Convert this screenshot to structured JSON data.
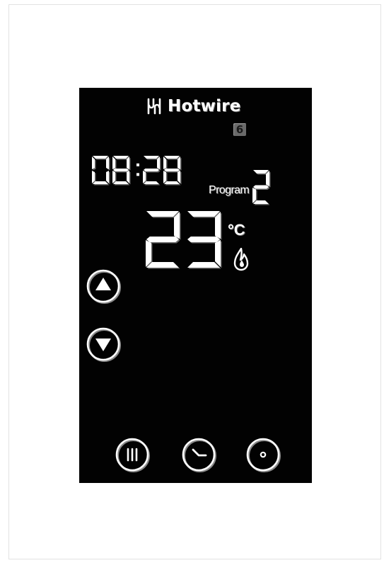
{
  "brand": {
    "name": "Hotwire",
    "logo_icon": "hotwire-logo-icon"
  },
  "status": {
    "day": "6"
  },
  "display": {
    "time": "08:28",
    "program_label": "Program",
    "program_number": "2",
    "temperature": "23",
    "unit": "°C",
    "heating_icon": "flame-icon"
  },
  "buttons": {
    "up": "up-arrow-icon",
    "down": "down-arrow-icon",
    "mode": "mode-bars-icon",
    "clock": "clock-icon",
    "power": "power-dot-icon"
  },
  "colors": {
    "screen": "#020202",
    "segment": "#ffffff",
    "bezel": "#ffffff"
  }
}
